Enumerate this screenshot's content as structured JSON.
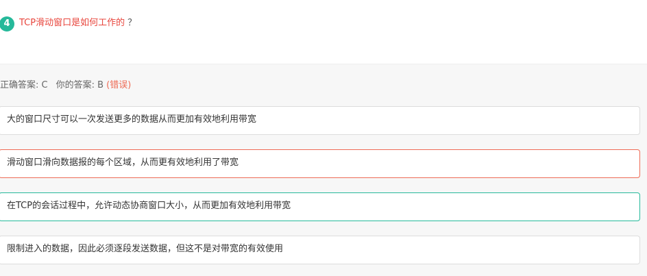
{
  "question": {
    "number": "4",
    "title": "TCP滑动窗口是如何工作的",
    "question_mark": "？"
  },
  "result": {
    "correct_label": "正确答案: C",
    "your_label": "你的答案: B",
    "status": "(错误)"
  },
  "options": [
    {
      "text": "大的窗口尺寸可以一次发送更多的数据从而更加有效地利用带宽"
    },
    {
      "text": "滑动窗口滑向数据报的每个区域，从而更有效地利用了带宽"
    },
    {
      "text": "在TCP的会话过程中，允许动态协商窗口大小，从而更加有效地利用带宽"
    },
    {
      "text": "限制进入的数据，因此必须逐段发送数据，但这不是对带宽的有效使用"
    }
  ],
  "colors": {
    "badge": "#25b99a",
    "title": "#e8453c",
    "wrong": "#ee6b55",
    "correct": "#25b99a"
  }
}
